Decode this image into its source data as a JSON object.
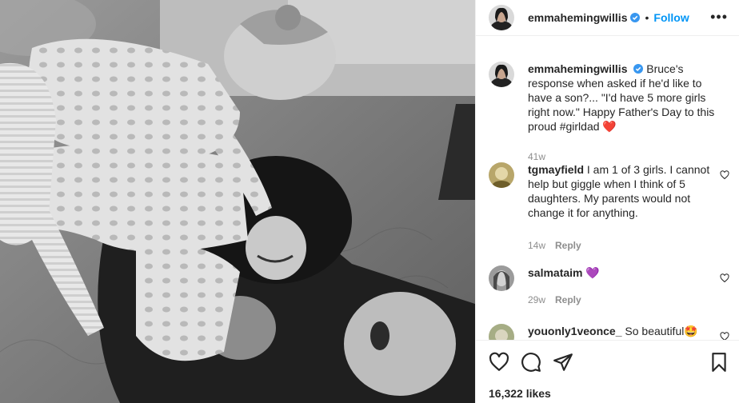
{
  "post": {
    "author": "emmahemingwillis",
    "follow_label": "Follow",
    "separator": "•",
    "more_label": "•••"
  },
  "caption": {
    "username": "emmahemingwillis",
    "text": "Bruce's response when asked if he'd like to have a son?... \"I'd have 5 more girls right now.\" Happy Father's Day to this proud #girldad",
    "emoji": "❤️",
    "age": "41w"
  },
  "comments": [
    {
      "username": "tgmayfield",
      "text": "I am 1 of 3 girls. I cannot help but giggle when I think of 5 daughters. My parents would not change it for anything.",
      "age": "14w",
      "reply_label": "Reply"
    },
    {
      "username": "salmataim",
      "text": "💜",
      "age": "29w",
      "reply_label": "Reply"
    },
    {
      "username": "youonly1veonce_",
      "text": "So beautiful🤩",
      "age": "",
      "reply_label": ""
    }
  ],
  "likes_text": "16,322 likes",
  "icons": {
    "like": "heart-icon",
    "comment": "comment-icon",
    "share": "paper-plane-icon",
    "save": "bookmark-icon",
    "verified": "verified-badge-icon"
  },
  "colors": {
    "accent": "#0095f6",
    "text": "#262626",
    "secondary": "#8e8e8e",
    "border": "#efefef"
  }
}
